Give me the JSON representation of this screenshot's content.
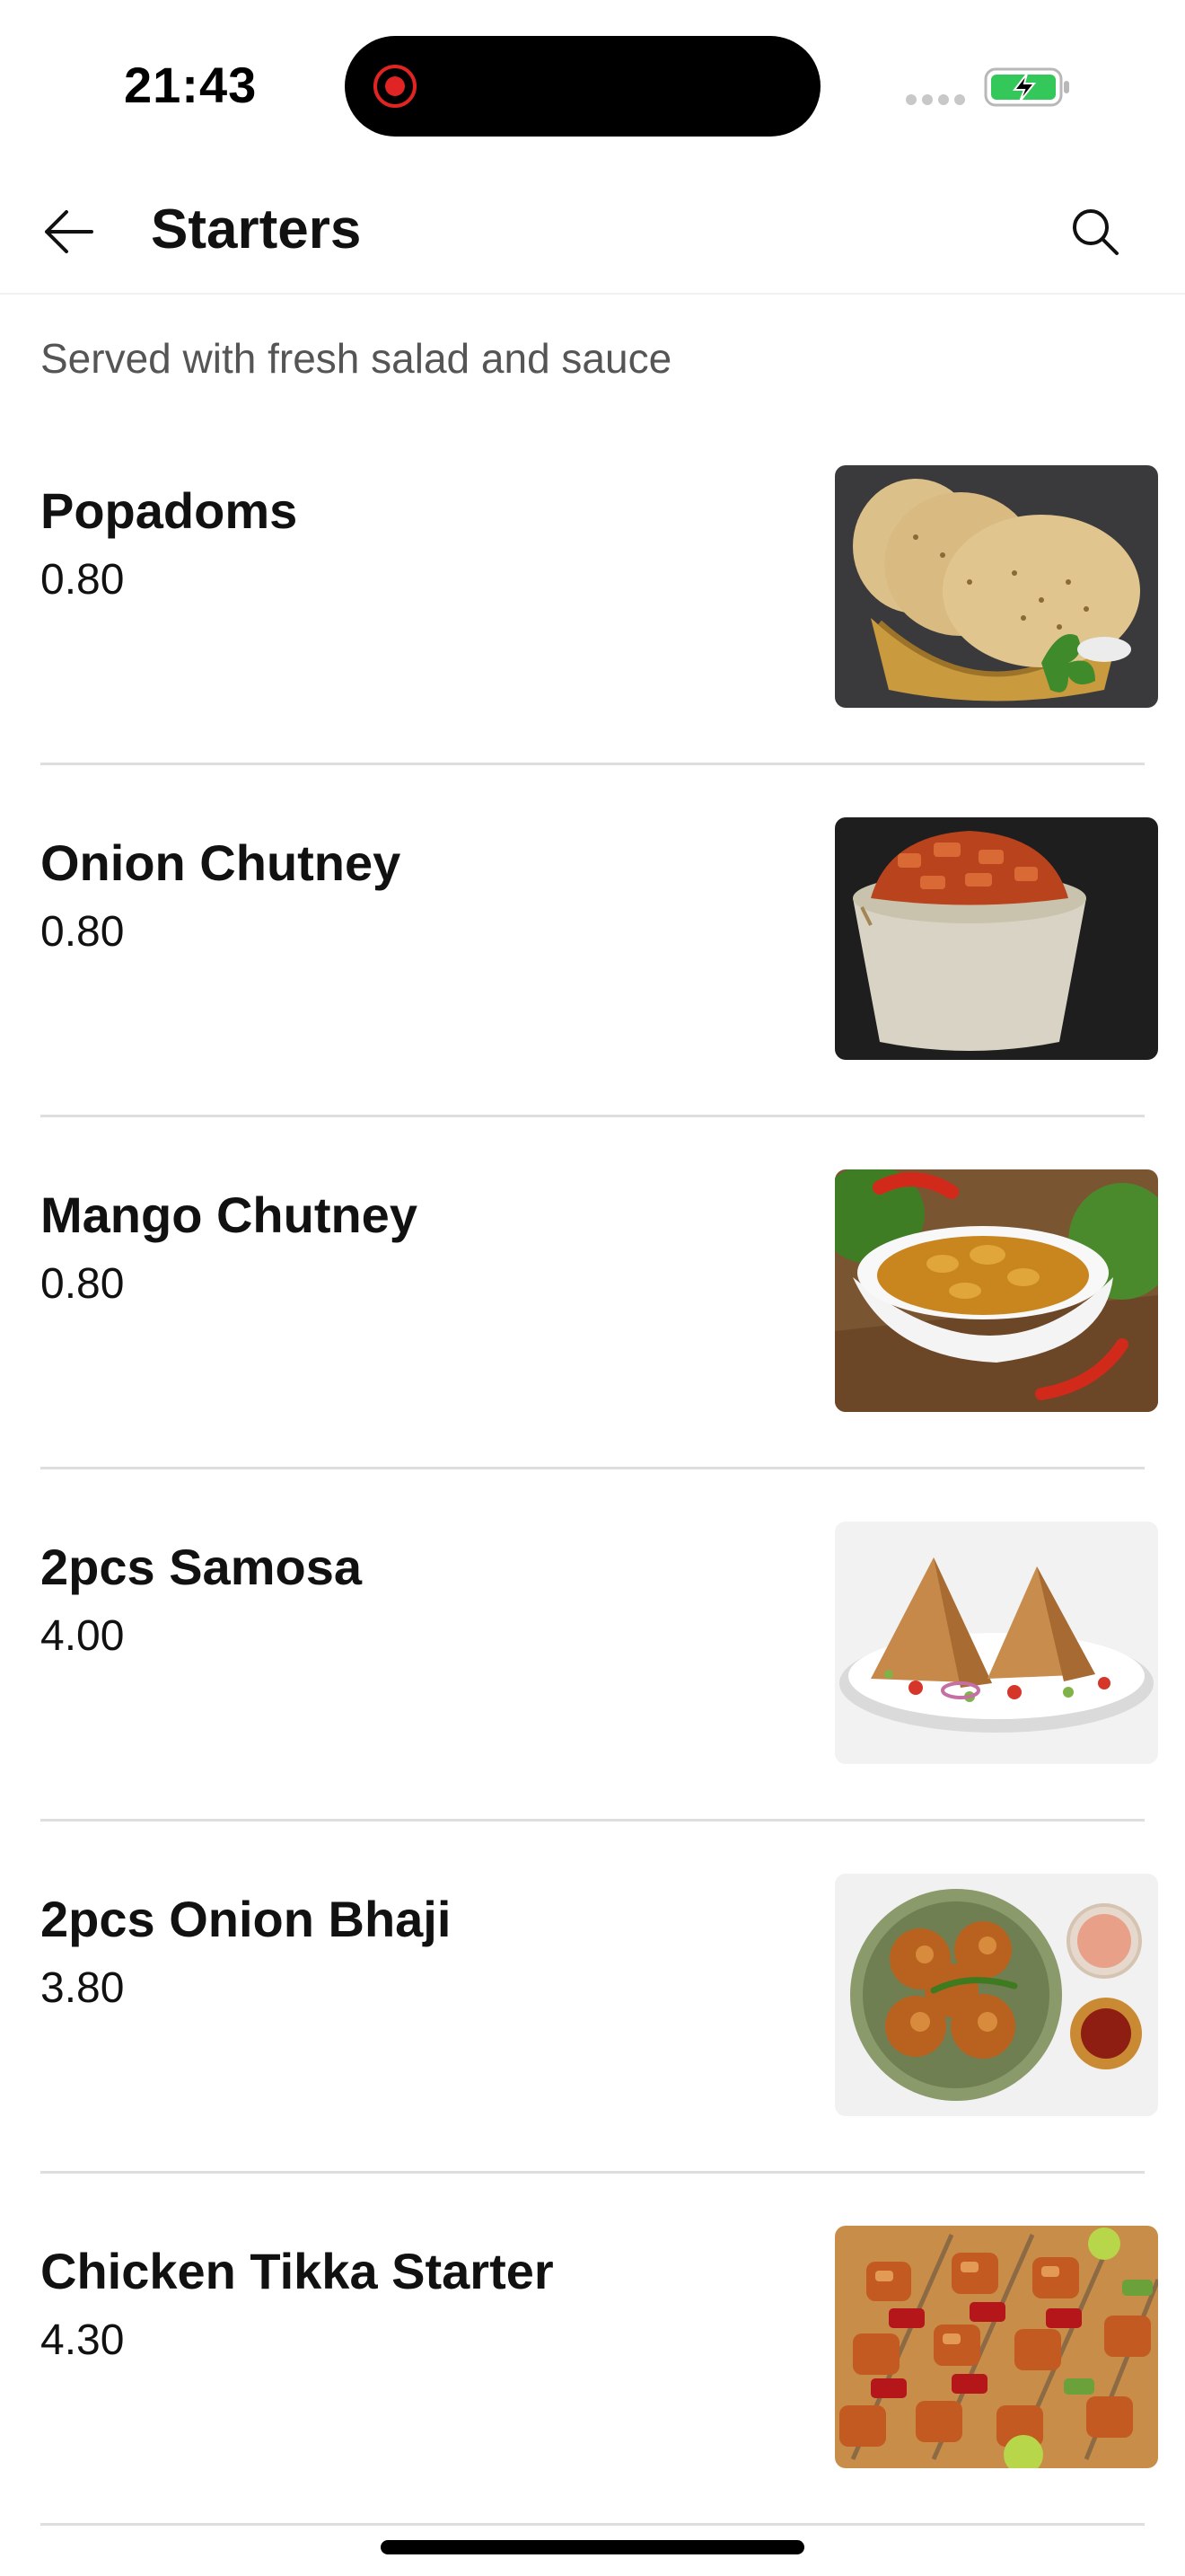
{
  "status_bar": {
    "time": "21:43",
    "recording_icon": "record-dot-icon",
    "signal_icon": "cellular-signal-icon",
    "battery_icon": "battery-charging-icon",
    "battery_color": "#34c759",
    "recording_color": "#e02424"
  },
  "header": {
    "back_icon": "arrow-left-icon",
    "title": "Starters",
    "search_icon": "search-icon"
  },
  "subtitle": "Served with fresh salad and sauce",
  "items": [
    {
      "name": "Popadoms",
      "price": "0.80",
      "image": "popadoms-photo"
    },
    {
      "name": "Onion Chutney",
      "price": "0.80",
      "image": "onion-chutney-photo"
    },
    {
      "name": "Mango Chutney",
      "price": "0.80",
      "image": "mango-chutney-photo"
    },
    {
      "name": "2pcs Samosa",
      "price": "4.00",
      "image": "samosa-photo"
    },
    {
      "name": "2pcs Onion Bhaji",
      "price": "3.80",
      "image": "onion-bhaji-photo"
    },
    {
      "name": "Chicken Tikka Starter",
      "price": "4.30",
      "image": "chicken-tikka-photo"
    }
  ]
}
